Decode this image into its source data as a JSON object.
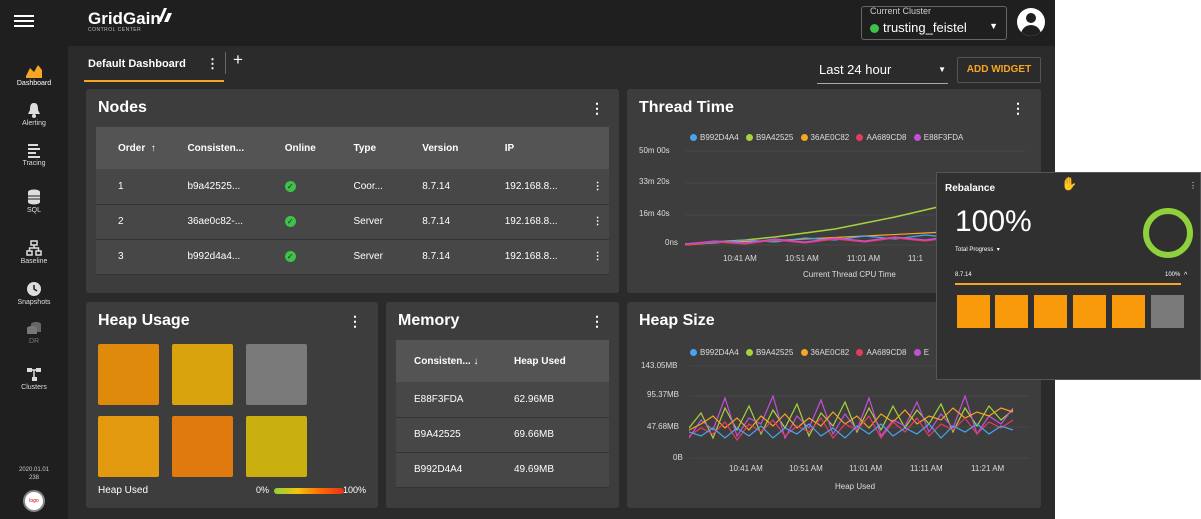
{
  "topbar": {
    "brand": "GridGain",
    "brand_sub": "CONTROL CENTER",
    "cluster_label": "Current Cluster",
    "cluster_name": "trusting_feistel",
    "cluster_status_color": "#3ec24a"
  },
  "sidebar": {
    "items": [
      {
        "label": "Dashboard",
        "icon": "dashboard-icon"
      },
      {
        "label": "Alerting",
        "icon": "bell-icon"
      },
      {
        "label": "Tracing",
        "icon": "tracing-icon"
      },
      {
        "label": "SQL",
        "icon": "database-icon"
      },
      {
        "label": "Baseline",
        "icon": "baseline-icon"
      },
      {
        "label": "Snapshots",
        "icon": "clock-icon"
      },
      {
        "label": "DR",
        "icon": "dr-icon"
      },
      {
        "label": "Clusters",
        "icon": "clusters-icon"
      }
    ],
    "version": "2020.01.01",
    "build": "238"
  },
  "tabs": {
    "active": "Default Dashboard",
    "period": "Last 24 hour",
    "add_widget": "ADD WIDGET"
  },
  "nodes": {
    "title": "Nodes",
    "columns": [
      "Order",
      "Consisten...",
      "Online",
      "Type",
      "Version",
      "IP"
    ],
    "sort_arrow": "↑",
    "rows": [
      {
        "order": "1",
        "id": "b9a42525...",
        "type": "Coor...",
        "version": "8.7.14",
        "ip": "192.168.8..."
      },
      {
        "order": "2",
        "id": "36ae0c82-...",
        "type": "Server",
        "version": "8.7.14",
        "ip": "192.168.8..."
      },
      {
        "order": "3",
        "id": "b992d4a4...",
        "type": "Server",
        "version": "8.7.14",
        "ip": "192.168.8..."
      }
    ]
  },
  "thread_time": {
    "title": "Thread Time",
    "legend": [
      "B992D4A4",
      "B9A42525",
      "36AE0C82",
      "AA689CD8",
      "E88F3FDA"
    ],
    "legend_colors": [
      "#4aa3f0",
      "#a6d33c",
      "#f5a623",
      "#e83a5f",
      "#c44fd8"
    ],
    "y_ticks": [
      "50m 00s",
      "33m 20s",
      "16m 40s",
      "0ns"
    ],
    "x_ticks": [
      "10:41 AM",
      "10:51 AM",
      "11:01 AM",
      "11:1"
    ],
    "xlabel": "Current Thread CPU Time"
  },
  "heap_usage": {
    "title": "Heap Usage",
    "label": "Heap Used",
    "scale_min": "0%",
    "scale_max": "100%",
    "tiles": [
      "#e08a0c",
      "#d9a30e",
      "#7a7a7a",
      "#e39a10",
      "#e07a0e",
      "#c9b010"
    ]
  },
  "memory": {
    "title": "Memory",
    "columns": [
      "Consisten...",
      "Heap Used"
    ],
    "sort_arrow": "↓",
    "rows": [
      {
        "id": "E88F3FDA",
        "heap": "62.96MB"
      },
      {
        "id": "B9A42525",
        "heap": "69.66MB"
      },
      {
        "id": "B992D4A4",
        "heap": "49.69MB"
      }
    ]
  },
  "heap_size": {
    "title": "Heap Size",
    "legend": [
      "B992D4A4",
      "B9A42525",
      "36AE0C82",
      "AA689CD8",
      "E"
    ],
    "y_ticks": [
      "143.05MB",
      "95.37MB",
      "47.68MB",
      "0B"
    ],
    "x_ticks": [
      "10:41 AM",
      "10:51 AM",
      "11:01 AM",
      "11:11 AM",
      "11:21 AM"
    ],
    "xlabel": "Heap Used"
  },
  "rebalance": {
    "title": "Rebalance",
    "percent": "100%",
    "sub": "Total Progress",
    "node": "8.7.14",
    "node_pct": "100%",
    "progress": 1.0
  }
}
